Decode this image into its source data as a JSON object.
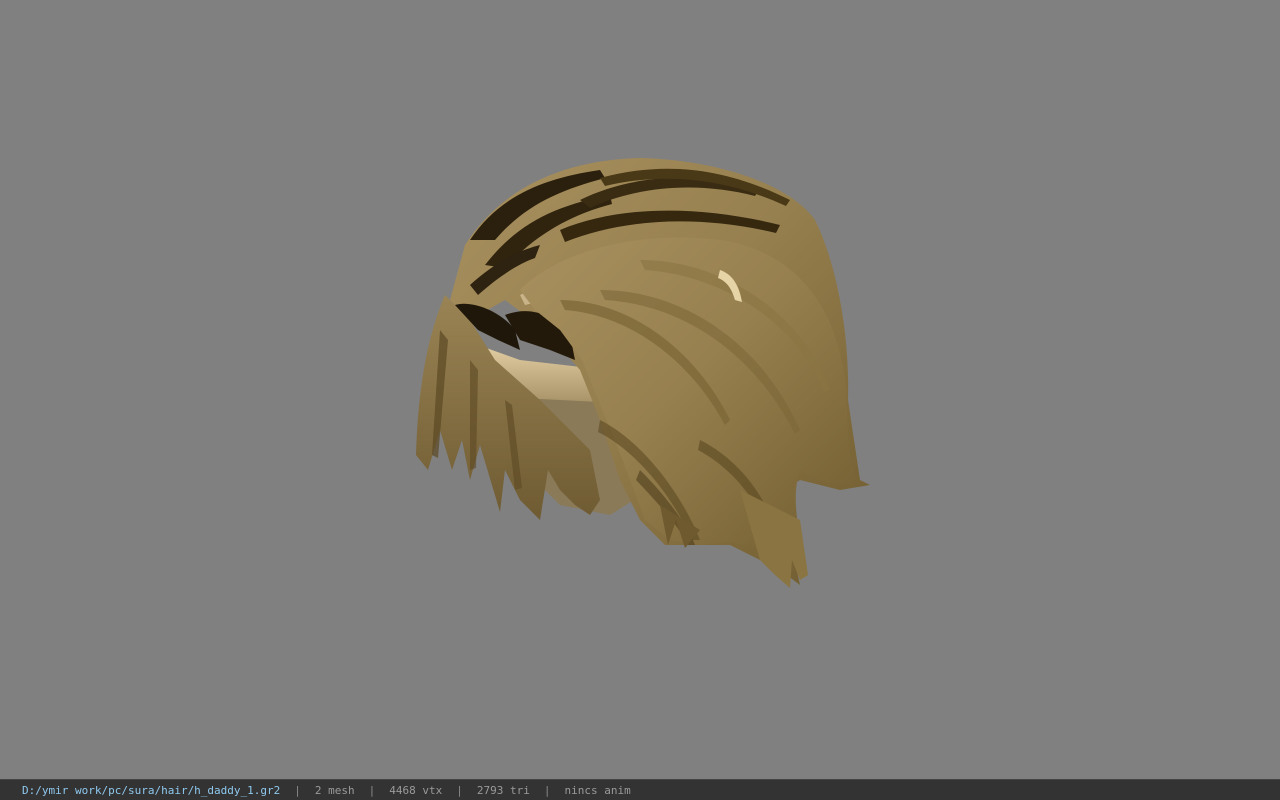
{
  "viewport": {
    "background": "#808080",
    "model": "hair-model"
  },
  "statusbar": {
    "file_path": "D:/ymir work/pc/sura/hair/h_daddy_1.gr2",
    "separator": "|",
    "mesh_count": "2 mesh",
    "vertex_count": "4468 vtx",
    "triangle_count": "2793 tri",
    "animation": "nincs anim",
    "path_color": "#8ec8ee"
  }
}
